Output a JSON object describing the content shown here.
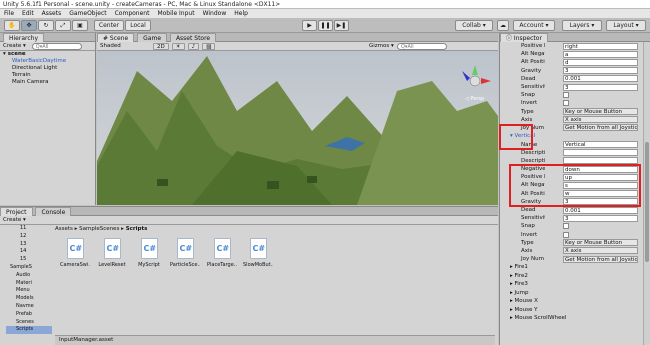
{
  "window_title": "Unity 5.6.1f1 Personal - scene.unity - createCameras - PC, Mac & Linux Standalone <DX11>",
  "menu": [
    "File",
    "Edit",
    "Assets",
    "GameObject",
    "Component",
    "Mobile Input",
    "Window",
    "Help"
  ],
  "toolbar": {
    "center": "Center",
    "local": "Local",
    "collab": "Collab ▾",
    "account": "Account ▾",
    "layers": "Layers ▾",
    "layout": "Layout ▾"
  },
  "hierarchy": {
    "tab": "Hierarchy",
    "create": "Create ▾",
    "search": "Q▾All",
    "scene": "scene",
    "items": [
      "WaterBasicDaytime",
      "Directional Light",
      "Terrain",
      "Main Camera"
    ]
  },
  "scene": {
    "tabs": [
      "# Scene",
      "Game",
      "Asset Store"
    ],
    "shading": "Shaded",
    "mode2d": "2D",
    "gizmos": "Gizmos ▾",
    "search": "Q▾All",
    "persp": "◁ Persp"
  },
  "project": {
    "tabs": [
      "Project",
      "Console"
    ],
    "create": "Create ▾",
    "breadcrumb": [
      "Assets",
      "SampleScenes",
      "Scripts"
    ],
    "tree": [
      "11",
      "12",
      "13",
      "14",
      "15",
      "SampleS",
      "Audio",
      "Materi",
      "Menu",
      "Models",
      "Navme",
      "Prefab",
      "Scenes",
      "Scripts"
    ],
    "files": [
      "CameraSwi...",
      "LevelReset",
      "MyScript",
      "ParticleSce...",
      "PlaceTarge...",
      "SlowMoBut..."
    ],
    "footer": "InputManager.asset"
  },
  "inspector": {
    "tab": "Inspector",
    "top_rows": [
      {
        "label": "Positive Button",
        "value": "right",
        "type": "text"
      },
      {
        "label": "Alt Negative Bu",
        "value": "a",
        "type": "text"
      },
      {
        "label": "Alt Positive But",
        "value": "d",
        "type": "text"
      },
      {
        "label": "Gravity",
        "value": "3",
        "type": "text"
      },
      {
        "label": "Dead",
        "value": "0.001",
        "type": "text"
      },
      {
        "label": "Sensitivity",
        "value": "3",
        "type": "text"
      },
      {
        "label": "Snap",
        "value": "",
        "type": "check"
      },
      {
        "label": "Invert",
        "value": "",
        "type": "check"
      },
      {
        "label": "Type",
        "value": "Key or Mouse Button",
        "type": "dd"
      },
      {
        "label": "Axis",
        "value": "X axis",
        "type": "dd"
      },
      {
        "label": "Joy Num",
        "value": "Get Motion from all Joysticks",
        "type": "dd"
      }
    ],
    "vertical": "Vertical",
    "v_rows": [
      {
        "label": "Name",
        "value": "Vertical",
        "type": "text"
      },
      {
        "label": "Descriptive Nar",
        "value": "",
        "type": "text"
      },
      {
        "label": "Descriptive Neg",
        "value": "",
        "type": "text"
      },
      {
        "label": "Negative Button",
        "value": "down",
        "type": "text"
      },
      {
        "label": "Positive Button",
        "value": "up",
        "type": "text"
      },
      {
        "label": "Alt Negative Bu",
        "value": "s",
        "type": "text"
      },
      {
        "label": "Alt Positive But",
        "value": "w",
        "type": "text"
      },
      {
        "label": "Gravity",
        "value": "3",
        "type": "text"
      },
      {
        "label": "Dead",
        "value": "0.001",
        "type": "text"
      },
      {
        "label": "Sensitivity",
        "value": "3",
        "type": "text"
      },
      {
        "label": "Snap",
        "value": "",
        "type": "check"
      },
      {
        "label": "Invert",
        "value": "",
        "type": "check"
      },
      {
        "label": "Type",
        "value": "Key or Mouse Button",
        "type": "dd"
      },
      {
        "label": "Axis",
        "value": "X axis",
        "type": "dd"
      },
      {
        "label": "Joy Num",
        "value": "Get Motion from all Joysticks",
        "type": "dd"
      }
    ],
    "folds": [
      "Fire1",
      "Fire2",
      "Fire3",
      "Jump",
      "Mouse X",
      "Mouse Y",
      "Mouse ScrollWheel"
    ]
  }
}
